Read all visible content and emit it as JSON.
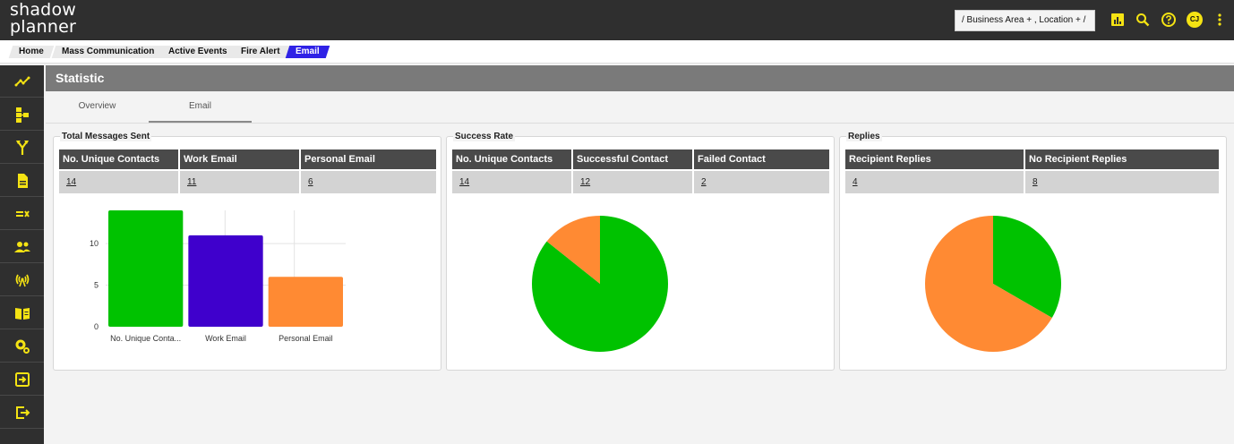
{
  "header": {
    "logo_line1": "shadow",
    "logo_line2": "planner",
    "filter_text": "/ Business Area + , Location + /",
    "avatar_initials": "CJ",
    "icons": [
      "bar-chart-icon",
      "search-icon",
      "help-icon",
      "avatar",
      "more-vertical-icon"
    ],
    "accent_color": "#f5e313"
  },
  "breadcrumb": {
    "items": [
      "Home",
      "Mass Communication",
      "Active Events",
      "Fire Alert",
      "Email"
    ],
    "active_index": 4
  },
  "sidebar": {
    "icons": [
      "analytics-icon",
      "hierarchy-icon",
      "branch-icon",
      "document-icon",
      "task-list-icon",
      "people-icon",
      "broadcast-icon",
      "book-icon",
      "settings-icon",
      "login-icon",
      "logout-icon"
    ]
  },
  "section": {
    "title": "Statistic"
  },
  "tabs": {
    "items": [
      "Overview",
      "Email"
    ],
    "active_index": 1
  },
  "panels": {
    "total": {
      "legend": "Total Messages Sent",
      "headers": [
        "No. Unique Contacts",
        "Work Email",
        "Personal Email"
      ],
      "values": [
        "14",
        "11",
        "6"
      ]
    },
    "success": {
      "legend": "Success Rate",
      "headers": [
        "No. Unique Contacts",
        "Successful Contact",
        "Failed Contact"
      ],
      "values": [
        "14",
        "12",
        "2"
      ]
    },
    "replies": {
      "legend": "Replies",
      "headers": [
        "Recipient Replies",
        "No Recipient Replies"
      ],
      "values": [
        "4",
        "8"
      ]
    }
  },
  "chart_data": [
    {
      "type": "bar",
      "categories": [
        "No. Unique Conta...",
        "Work Email",
        "Personal Email"
      ],
      "values": [
        14,
        11,
        6
      ],
      "colors": [
        "#00c200",
        "#3f00cc",
        "#ff8a33"
      ],
      "yticks": [
        0,
        5,
        10
      ],
      "ylim": [
        0,
        14
      ],
      "grid": true
    },
    {
      "type": "pie",
      "labels": [
        "Successful Contact",
        "Failed Contact"
      ],
      "values": [
        12,
        2
      ],
      "colors": [
        "#00c200",
        "#ff8a33"
      ]
    },
    {
      "type": "pie",
      "labels": [
        "Recipient Replies",
        "No Recipient Replies"
      ],
      "values": [
        4,
        8
      ],
      "colors": [
        "#00c200",
        "#ff8a33"
      ]
    }
  ]
}
